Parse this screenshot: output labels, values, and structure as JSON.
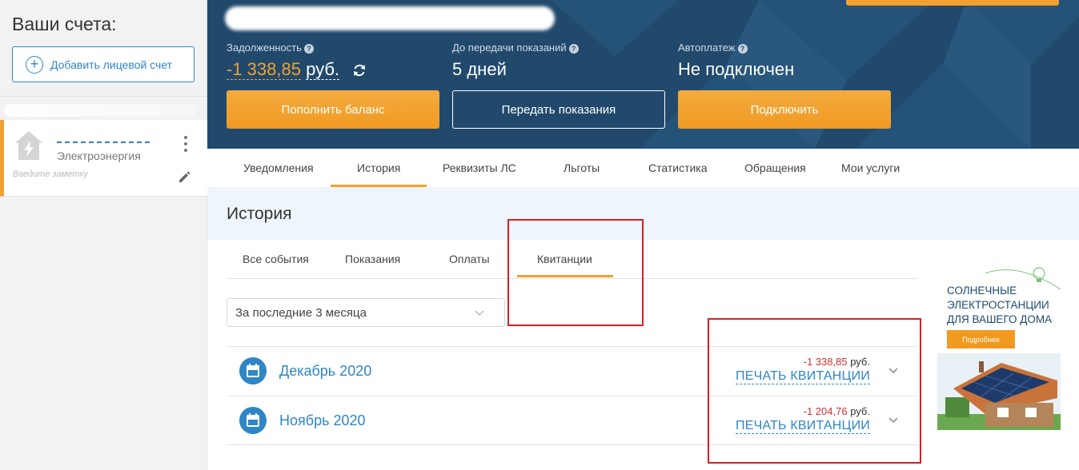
{
  "sidebar": {
    "title": "Ваши счета:",
    "add_account_label": "Добавить лицевой счет",
    "account": {
      "service": "Электроэнергия",
      "note_placeholder": "Введите заметку"
    }
  },
  "header": {
    "debt": {
      "label": "Задолженность",
      "amount": "-1 338,85",
      "currency": "руб."
    },
    "readings": {
      "label": "До передачи показаний",
      "value": "5 дней"
    },
    "autopay": {
      "label": "Автоплатеж",
      "value": "Не подключен"
    },
    "buttons": {
      "top_up": "Пополнить баланс",
      "submit_readings": "Передать показания",
      "connect": "Подключить"
    }
  },
  "tabs": [
    "Уведомления",
    "История",
    "Реквизиты ЛС",
    "Льготы",
    "Статистика",
    "Обращения",
    "Мои услуги"
  ],
  "active_tab": "История",
  "history": {
    "title": "История",
    "subtabs": [
      "Все события",
      "Показания",
      "Оплаты",
      "Квитанции"
    ],
    "active_subtab": "Квитанции",
    "period": "За последние 3 месяца",
    "rows": [
      {
        "month": "Декабрь 2020",
        "amount": "-1 338,85",
        "currency": "руб.",
        "print_label": "ПЕЧАТЬ КВИТАНЦИИ"
      },
      {
        "month": "Ноябрь 2020",
        "amount": "-1 204,76",
        "currency": "руб.",
        "print_label": "ПЕЧАТЬ КВИТАНЦИИ"
      }
    ]
  },
  "ad": {
    "line1": "СОЛНЕЧНЫЕ",
    "line2": "ЭЛЕКТРОСТАНЦИИ",
    "line3": "ДЛЯ ВАШЕГО ДОМА",
    "button": "Подробнее"
  },
  "colors": {
    "accent_orange": "#f2a131",
    "link_blue": "#2f86c6",
    "header_bg": "#21496c",
    "negative_red": "#d0312d",
    "annotation_red": "#d81f26"
  }
}
